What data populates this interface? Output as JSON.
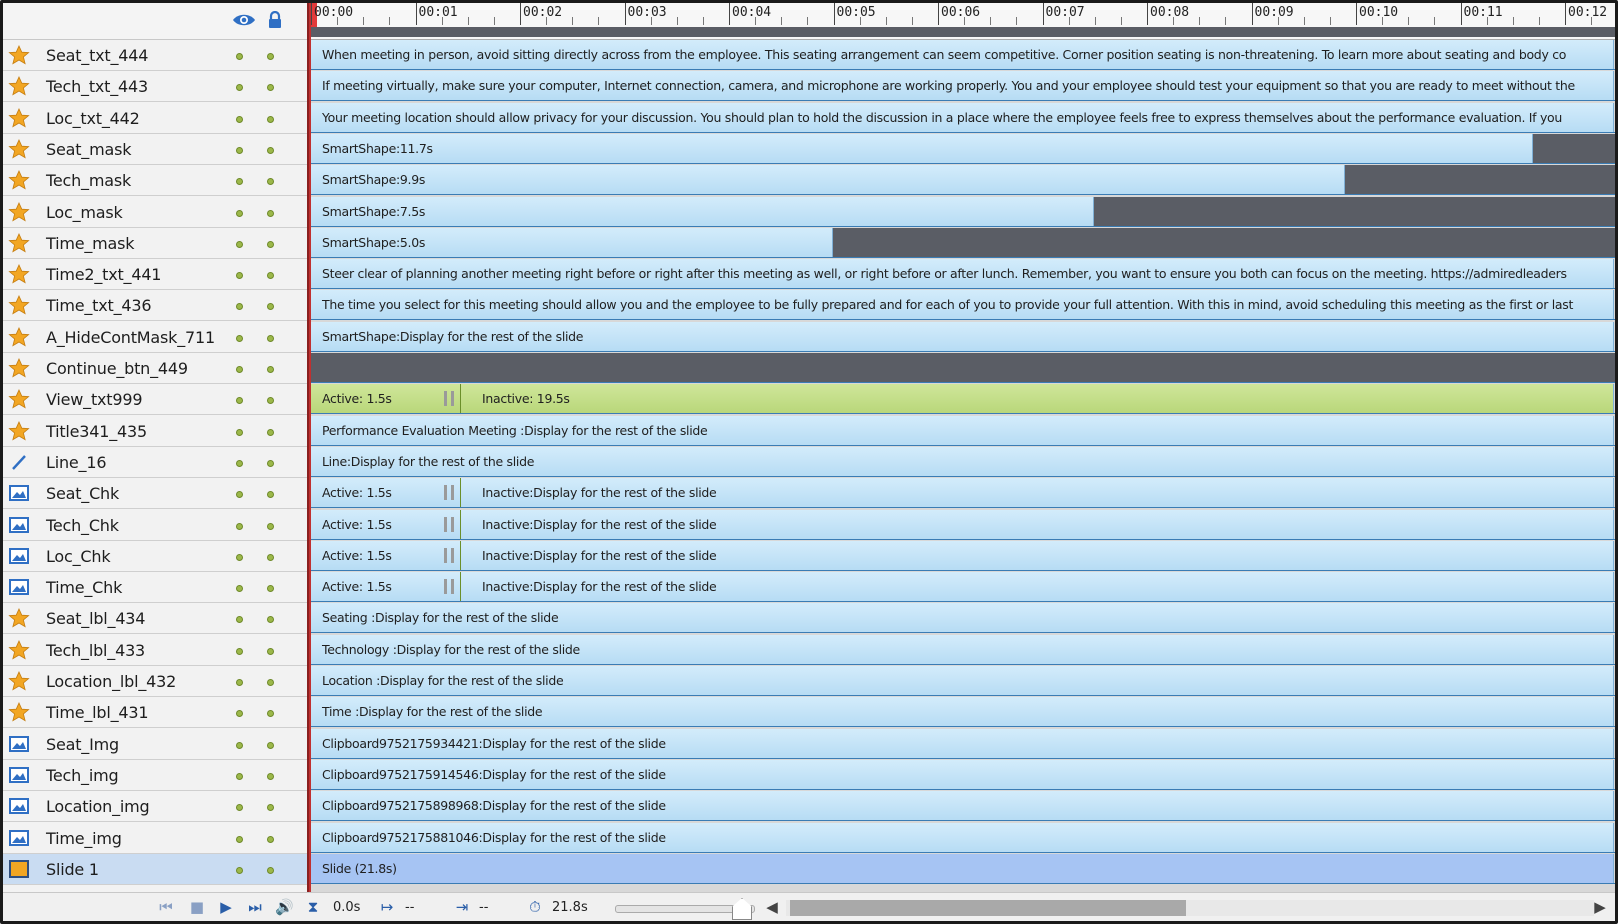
{
  "ruler": {
    "labels": [
      "00:00",
      "00:01",
      "00:02",
      "00:03",
      "00:04",
      "00:05",
      "00:06",
      "00:07",
      "00:08",
      "00:09",
      "00:10",
      "00:11",
      "00:12"
    ]
  },
  "layers": [
    {
      "name": "Seat_txt_444",
      "icon": "star",
      "bar": "When meeting in person, avoid sitting directly across from the employee.    This seating arrangement can seem competitive. Corner position seating is non-threatening.    To learn more about seating and body co"
    },
    {
      "name": "Tech_txt_443",
      "icon": "star",
      "bar": "If meeting virtually, make sure your computer, Internet connection, camera, and microphone are working properly.    You and your employee should test your equipment so that you are ready to meet without the"
    },
    {
      "name": "Loc_txt_442",
      "icon": "star",
      "bar": "Your meeting location should allow privacy for your discussion.    You should plan to hold the discussion in a place where the employee feels free to express themselves about the performance evaluation.    If you"
    },
    {
      "name": "Seat_mask",
      "icon": "star",
      "bar": "SmartShape:11.7s"
    },
    {
      "name": "Tech_mask",
      "icon": "star",
      "bar": "SmartShape:9.9s"
    },
    {
      "name": "Loc_mask",
      "icon": "star",
      "bar": "SmartShape:7.5s"
    },
    {
      "name": "Time_mask",
      "icon": "star",
      "bar": "SmartShape:5.0s"
    },
    {
      "name": "Time2_txt_441",
      "icon": "star",
      "bar": "Steer clear of planning another meeting right before or right after this meeting as well, or right before or after lunch.    Remember, you want to ensure you both can focus on the meeting.    https://admiredleaders"
    },
    {
      "name": "Time_txt_436",
      "icon": "star",
      "bar": "The time you select for this meeting should allow you and the employee to be fully prepared and for each of you to provide your full attention.    With this in mind, avoid scheduling this meeting as the first or last"
    },
    {
      "name": "A_HideContMask_711",
      "icon": "star",
      "bar": "SmartShape:Display for the rest of the slide"
    },
    {
      "name": "Continue_btn_449",
      "icon": "star",
      "bar": ""
    },
    {
      "name": "View_txt999",
      "icon": "star",
      "bar": "Active: 1.5s",
      "bar2": "Inactive: 19.5s"
    },
    {
      "name": "Title341_435",
      "icon": "star",
      "bar": "Performance Evaluation Meeting :Display for the rest of the slide"
    },
    {
      "name": "Line_16",
      "icon": "line",
      "bar": "Line:Display for the rest of the slide"
    },
    {
      "name": "Seat_Chk",
      "icon": "image",
      "bar": "Active: 1.5s",
      "bar2": "Inactive:Display for the rest of the slide"
    },
    {
      "name": "Tech_Chk",
      "icon": "image",
      "bar": "Active: 1.5s",
      "bar2": "Inactive:Display for the rest of the slide"
    },
    {
      "name": "Loc_Chk",
      "icon": "image",
      "bar": "Active: 1.5s",
      "bar2": "Inactive:Display for the rest of the slide"
    },
    {
      "name": "Time_Chk",
      "icon": "image",
      "bar": "Active: 1.5s",
      "bar2": "Inactive:Display for the rest of the slide"
    },
    {
      "name": "Seat_lbl_434",
      "icon": "star",
      "bar": "Seating :Display for the rest of the slide"
    },
    {
      "name": "Tech_lbl_433",
      "icon": "star",
      "bar": "Technology :Display for the rest of the slide"
    },
    {
      "name": "Location_lbl_432",
      "icon": "star",
      "bar": "Location :Display for the rest of the slide"
    },
    {
      "name": "Time_lbl_431",
      "icon": "star",
      "bar": "Time :Display for the rest of the slide"
    },
    {
      "name": "Seat_Img",
      "icon": "image",
      "bar": "Clipboard9752175934421:Display for the rest of the slide"
    },
    {
      "name": "Tech_img",
      "icon": "image",
      "bar": "Clipboard9752175914546:Display for the rest of the slide"
    },
    {
      "name": "Location_img",
      "icon": "image",
      "bar": "Clipboard9752175898968:Display for the rest of the slide"
    },
    {
      "name": "Time_img",
      "icon": "image",
      "bar": "Clipboard9752175881046:Display for the rest of the slide"
    },
    {
      "name": "Slide 1",
      "icon": "slide",
      "bar": "Slide (21.8s)"
    }
  ],
  "footer": {
    "current_time": "0.0s",
    "start_time": "--",
    "duration": "--",
    "total": "21.8s"
  },
  "colors": {
    "bar": "#c6e6f8",
    "gray": "#5a5d65",
    "green": "#c4de8a",
    "slide": "#a6c4f3",
    "star": "#f2a623",
    "playhead": "#e23a3a"
  }
}
